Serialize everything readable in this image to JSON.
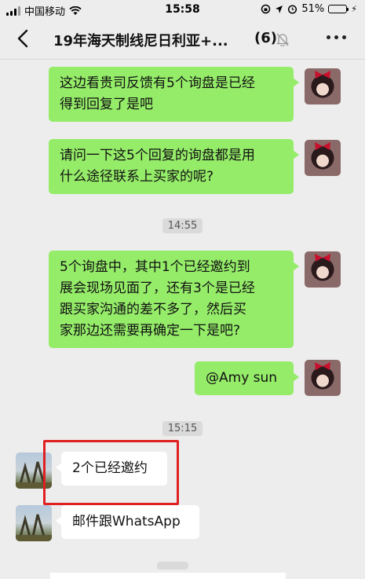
{
  "status_bar": {
    "carrier": "中国移动",
    "time": "15:58",
    "battery_percent": "51%",
    "battery_level": 0.51
  },
  "nav": {
    "title": "19年海天制线尼日利亚+...",
    "member_count": "(6)",
    "icons": [
      "back-arrow-icon",
      "mute-bell-icon",
      "more-icon"
    ]
  },
  "messages": [
    {
      "side": "sent",
      "text_lines": [
        "这边看贵司反馈有5个询盘是已经",
        "得到回复了是吧"
      ]
    },
    {
      "side": "sent",
      "text_lines": [
        "请问一下这5个回复的询盘都是用",
        "什么途径联系上买家的呢?"
      ]
    },
    {
      "timestamp": "14:55"
    },
    {
      "side": "sent",
      "text_lines": [
        "5个询盘中，其中1个已经邀约到",
        "展会现场见面了，还有3个是已经",
        "跟买家沟通的差不多了，然后买",
        "家那边还需要再确定一下是吧?"
      ]
    },
    {
      "side": "sent",
      "text_lines": [
        "@Amy sun"
      ]
    },
    {
      "timestamp": "15:15"
    },
    {
      "side": "received",
      "text_lines": [
        "2个已经邀约"
      ]
    },
    {
      "side": "received",
      "text_lines": [
        "邮件跟WhatsApp"
      ]
    }
  ],
  "colors": {
    "background": "#ededed",
    "sent_bubble": "#95ec69",
    "received_bubble": "#ffffff",
    "highlight": "#e02020"
  }
}
